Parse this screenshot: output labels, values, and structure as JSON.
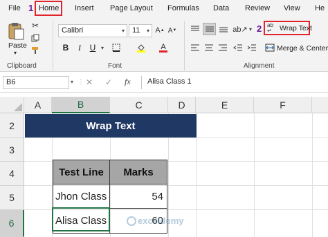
{
  "ribbon_tabs": [
    {
      "label": "File"
    },
    {
      "label": "Home"
    },
    {
      "label": "Insert"
    },
    {
      "label": "Page Layout"
    },
    {
      "label": "Formulas"
    },
    {
      "label": "Data"
    },
    {
      "label": "Review"
    },
    {
      "label": "View"
    },
    {
      "label": "He"
    }
  ],
  "steps": {
    "one": "1",
    "two": "2"
  },
  "clipboard": {
    "paste_label": "Paste",
    "group_label": "Clipboard"
  },
  "font": {
    "name": "Calibri",
    "size": "11",
    "group_label": "Font"
  },
  "alignment": {
    "wrap_text_label": "Wrap Text",
    "merge_label": "Merge & Center",
    "group_label": "Alignment"
  },
  "formula_bar": {
    "name_box": "B6",
    "fx": "fx",
    "formula": "Alisa Class 1"
  },
  "columns": [
    "A",
    "B",
    "C",
    "D",
    "E",
    "F"
  ],
  "rows": [
    "2",
    "3",
    "4",
    "5",
    "6"
  ],
  "sheet": {
    "title": "Wrap Text",
    "table_headers": [
      "Test Line",
      "Marks"
    ],
    "table_rows": [
      {
        "name": "Jhon Class",
        "marks": "54"
      },
      {
        "name": "Alisa Class",
        "marks": "60"
      }
    ]
  },
  "watermark": "exceldemy",
  "colors": {
    "accent": "#217346",
    "title_fill": "#203864",
    "header_fill": "#a6a6a6",
    "highlight": "#e3222b",
    "step": "#6a1b9a"
  }
}
